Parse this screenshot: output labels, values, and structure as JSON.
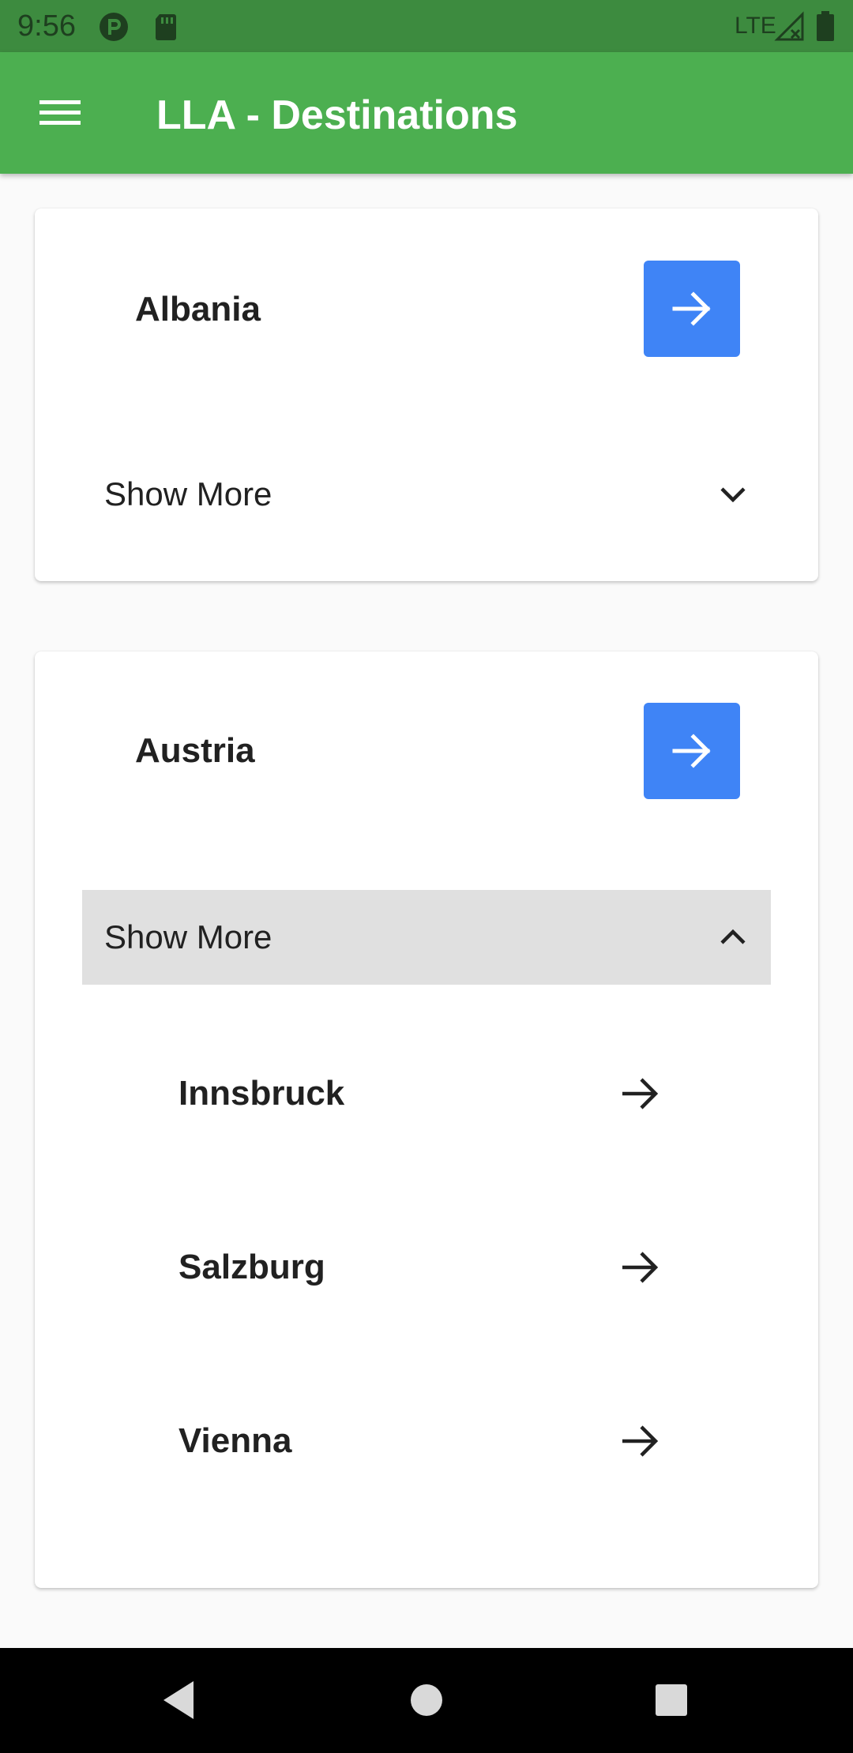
{
  "status_bar": {
    "time": "9:56",
    "network": "LTE",
    "icons": [
      "app-notification-icon",
      "sd-card-icon",
      "signal-icon",
      "battery-icon"
    ]
  },
  "app_bar": {
    "title": "LLA - Destinations",
    "menu_icon": "hamburger-menu-icon",
    "color": "#4caf50"
  },
  "cards": [
    {
      "title": "Albania",
      "go_icon": "arrow-right-icon",
      "show_more_label": "Show More",
      "expanded": false,
      "children": []
    },
    {
      "title": "Austria",
      "go_icon": "arrow-right-icon",
      "show_more_label": "Show More",
      "expanded": true,
      "children": [
        {
          "label": "Innsbruck"
        },
        {
          "label": "Salzburg"
        },
        {
          "label": "Vienna"
        }
      ]
    }
  ],
  "colors": {
    "accent_button": "#3f84f6",
    "expanded_header": "#e0e0e0",
    "status_bar": "#3d8b3f"
  },
  "nav_bar": {
    "buttons": [
      "back-icon",
      "home-icon",
      "recents-icon"
    ]
  }
}
